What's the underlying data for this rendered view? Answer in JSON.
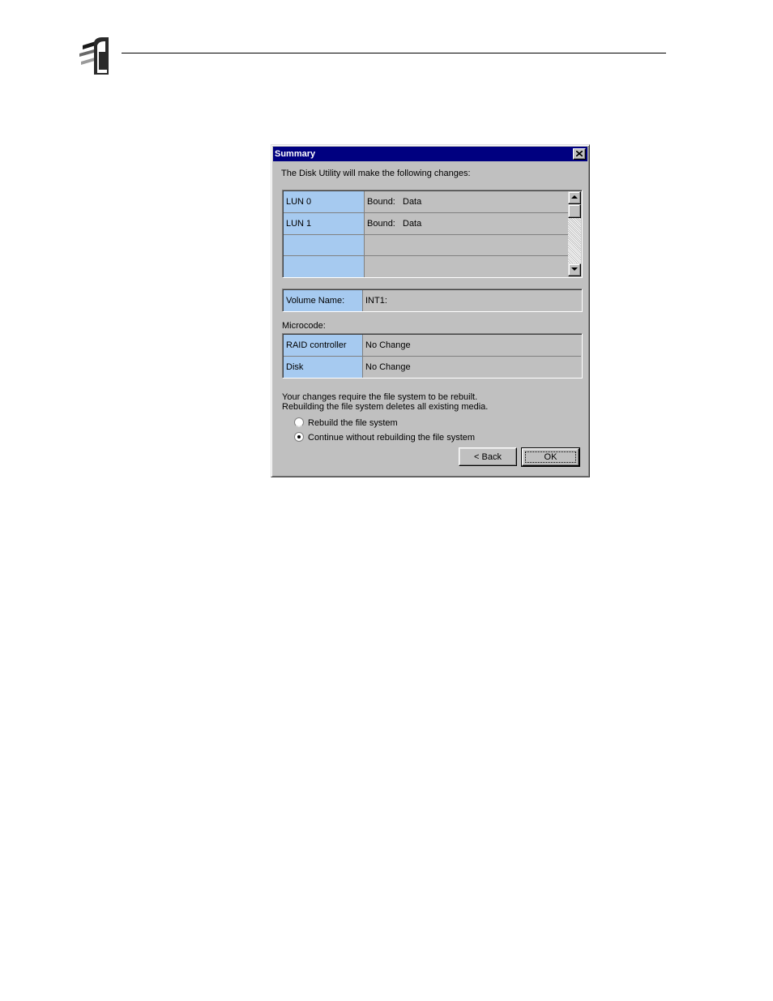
{
  "dialog": {
    "title": "Summary",
    "intro": "The Disk Utility will make the following changes:",
    "lun_table": [
      {
        "label": "LUN 0",
        "status": "Bound:",
        "type": "Data"
      },
      {
        "label": "LUN 1",
        "status": "Bound:",
        "type": "Data"
      },
      {
        "label": "",
        "status": "",
        "type": ""
      },
      {
        "label": "",
        "status": "",
        "type": ""
      }
    ],
    "volume": {
      "label": "Volume Name:",
      "value": "INT1:"
    },
    "microcode": {
      "heading": "Microcode:",
      "rows": [
        {
          "label": "RAID controller",
          "value": "No Change"
        },
        {
          "label": "Disk",
          "value": "No Change"
        }
      ]
    },
    "warning_line1": "Your changes require the file system to be rebuilt.",
    "warning_line2": "Rebuilding the file system deletes all existing media.",
    "options": [
      {
        "label": "Rebuild the file system",
        "selected": false
      },
      {
        "label": "Continue without rebuilding the file system",
        "selected": true
      }
    ],
    "buttons": {
      "back": "< Back",
      "ok": "OK"
    }
  },
  "colors": {
    "titlebar": "#000080",
    "label_cell": "#a6caf0",
    "face": "#c0c0c0"
  }
}
